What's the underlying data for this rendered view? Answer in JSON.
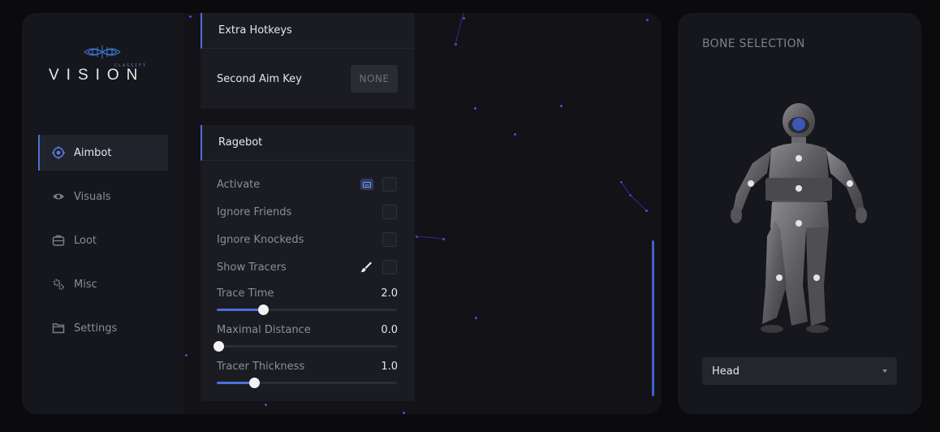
{
  "logo": {
    "subtitle": "CLASSIFY",
    "name": "VISION"
  },
  "sidebar": {
    "items": [
      {
        "label": "Aimbot",
        "icon": "crosshair-icon",
        "active": true
      },
      {
        "label": "Visuals",
        "icon": "eye-icon"
      },
      {
        "label": "Loot",
        "icon": "briefcase-icon"
      },
      {
        "label": "Misc",
        "icon": "gear-icon"
      },
      {
        "label": "Settings",
        "icon": "folder-icon"
      }
    ]
  },
  "extra_hotkeys": {
    "title": "Extra Hotkeys",
    "second_aim_key_label": "Second Aim Key",
    "second_aim_key_value": "NONE"
  },
  "ragebot": {
    "title": "Ragebot",
    "activate_label": "Activate",
    "ignore_friends_label": "Ignore Friends",
    "ignore_knocked_label": "Ignore Knockeds",
    "show_tracers_label": "Show Tracers",
    "trace_time": {
      "label": "Trace Time",
      "value": "2.0",
      "fraction": 0.25
    },
    "maximal_distance": {
      "label": "Maximal Distance",
      "value": "0.0",
      "fraction": 0.0
    },
    "tracer_thickness": {
      "label": "Tracer Thickness",
      "value": "1.0",
      "fraction": 0.2
    }
  },
  "bone_selection": {
    "title": "BONE SELECTION",
    "selected": "Head"
  },
  "colors": {
    "accent": "#4e6ed8",
    "particle": "#6b3fd6",
    "panel": "#1b1c22"
  }
}
